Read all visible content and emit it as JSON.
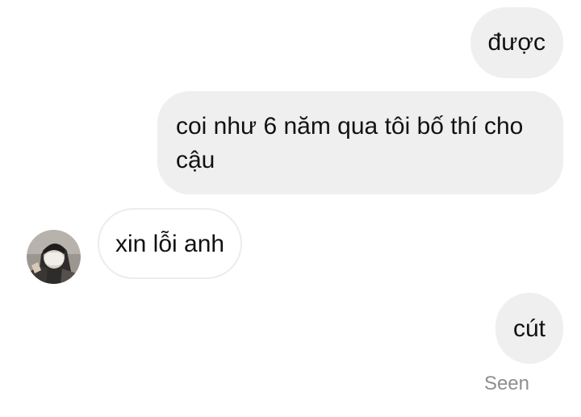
{
  "messages": [
    {
      "direction": "sent",
      "text": "được"
    },
    {
      "direction": "sent",
      "text": "coi như 6 năm qua tôi bố thí cho cậu"
    },
    {
      "direction": "received",
      "text": "xin lỗi anh"
    },
    {
      "direction": "sent",
      "text": "cút"
    }
  ],
  "status": {
    "seen_label": "Seen"
  },
  "colors": {
    "sent_bubble": "#efefef",
    "received_bubble": "#ffffff",
    "received_border": "#ececec",
    "text": "#111111",
    "seen": "#8e8e8e"
  },
  "icons": {
    "contact_avatar": "avatar-photo"
  }
}
